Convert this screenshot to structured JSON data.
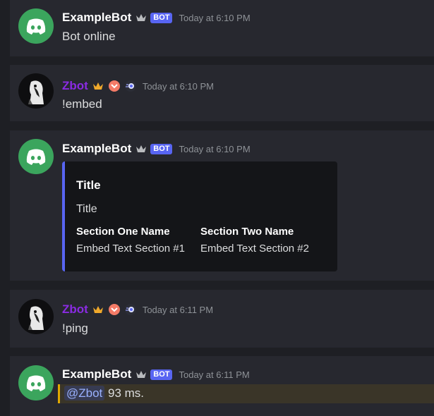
{
  "messages": [
    {
      "author": "ExampleBot",
      "badge": "BOT",
      "timestamp": "Today at 6:10 PM",
      "content": "Bot online"
    },
    {
      "author": "Zbot",
      "timestamp": "Today at 6:10 PM",
      "content": "!embed"
    },
    {
      "author": "ExampleBot",
      "badge": "BOT",
      "timestamp": "Today at 6:10 PM",
      "embed": {
        "title": "Title",
        "description": "Title",
        "fields": [
          {
            "name": "Section One Name",
            "value": "Embed Text Section #1"
          },
          {
            "name": "Section Two Name",
            "value": "Embed Text Section #2"
          }
        ],
        "accent_color": "#5865f2"
      }
    },
    {
      "author": "Zbot",
      "timestamp": "Today at 6:11 PM",
      "content": "!ping"
    },
    {
      "author": "ExampleBot",
      "badge": "BOT",
      "timestamp": "Today at 6:11 PM",
      "mention": "@Zbot",
      "content_after": "93 ms."
    }
  ],
  "colors": {
    "bot_badge": "#5865f2",
    "zbot_name": "#8a2be2",
    "discord_avatar": "#3ba55d",
    "mention_highlight_border": "#e0a800"
  },
  "icons": [
    "discord-logo-icon",
    "crown-icon",
    "nitro-boost-icon",
    "hypesquad-icon"
  ]
}
